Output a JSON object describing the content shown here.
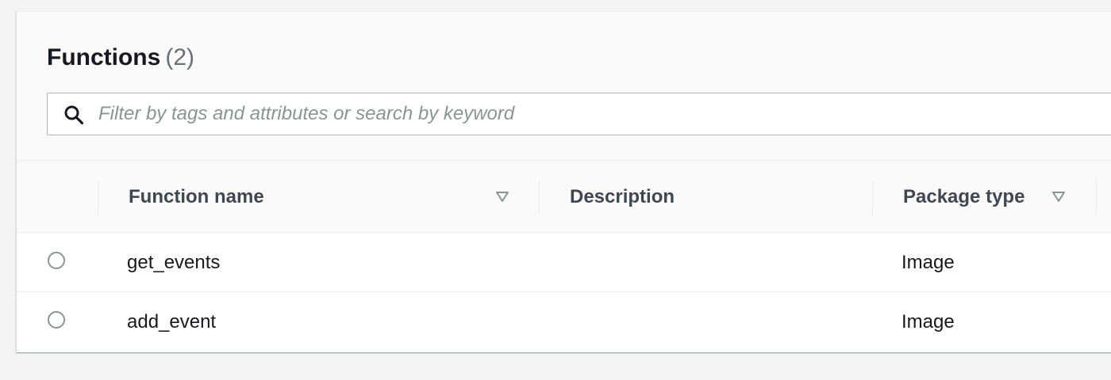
{
  "functions_panel": {
    "title": "Functions",
    "count": "(2)",
    "search": {
      "placeholder": "Filter by tags and attributes or search by keyword",
      "value": "",
      "icon": "search-icon"
    },
    "columns": [
      {
        "label": "Function name",
        "sortable": true
      },
      {
        "label": "Description",
        "sortable": false
      },
      {
        "label": "Package type",
        "sortable": true
      }
    ],
    "rows": [
      {
        "selected": false,
        "function_name": "get_events",
        "description": "",
        "package_type": "Image"
      },
      {
        "selected": false,
        "function_name": "add_event",
        "description": "",
        "package_type": "Image"
      }
    ]
  },
  "colors": {
    "page_background": "#f2f3f3",
    "header_background": "#fafafa",
    "text": "#16191f",
    "muted_text": "#687078",
    "border": "#aab7b8"
  }
}
